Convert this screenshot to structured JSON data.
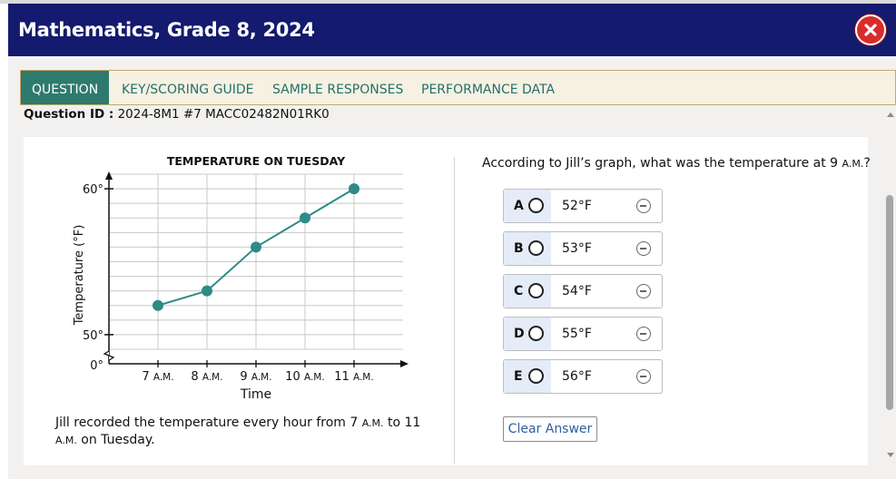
{
  "header": {
    "title": "Mathematics, Grade 8, 2024"
  },
  "tabs": [
    {
      "label": "QUESTION"
    },
    {
      "label": "KEY/SCORING GUIDE"
    },
    {
      "label": "SAMPLE RESPONSES"
    },
    {
      "label": "PERFORMANCE DATA"
    }
  ],
  "question_id": {
    "label": "Question ID :",
    "value": " 2024-8M1 #7 MACC02482N01RK0"
  },
  "chart_data": {
    "type": "line",
    "title": "TEMPERATURE ON TUESDAY",
    "xlabel": "Time",
    "ylabel": "Temperature (°F)",
    "categories": [
      "7 A.M.",
      "8 A.M.",
      "9 A.M.",
      "10 A.M.",
      "11 A.M."
    ],
    "values": [
      52,
      53,
      56,
      58,
      60
    ],
    "y_tick_labels": {
      "top": "60°",
      "bottom": "50°",
      "origin": "0°"
    },
    "ylim": [
      49,
      61
    ],
    "grid": true,
    "colors": {
      "line": "#2e8b86",
      "point": "#2e8b86",
      "grid": "#c8c8c8"
    }
  },
  "stem": {
    "part1": "Jill recorded the temperature every hour from 7 ",
    "sc1": "A.M.",
    "part2": " to 11 ",
    "sc2": "A.M.",
    "part3": " on Tuesday."
  },
  "question": {
    "part1": "According to Jill’s graph, what was the temperature at 9 ",
    "sc": "A.M.",
    "part2": "?"
  },
  "options": [
    {
      "letter": "A",
      "value": "52°F"
    },
    {
      "letter": "B",
      "value": "53°F"
    },
    {
      "letter": "C",
      "value": "54°F"
    },
    {
      "letter": "D",
      "value": "55°F"
    },
    {
      "letter": "E",
      "value": "56°F"
    }
  ],
  "clear_label": "Clear Answer"
}
